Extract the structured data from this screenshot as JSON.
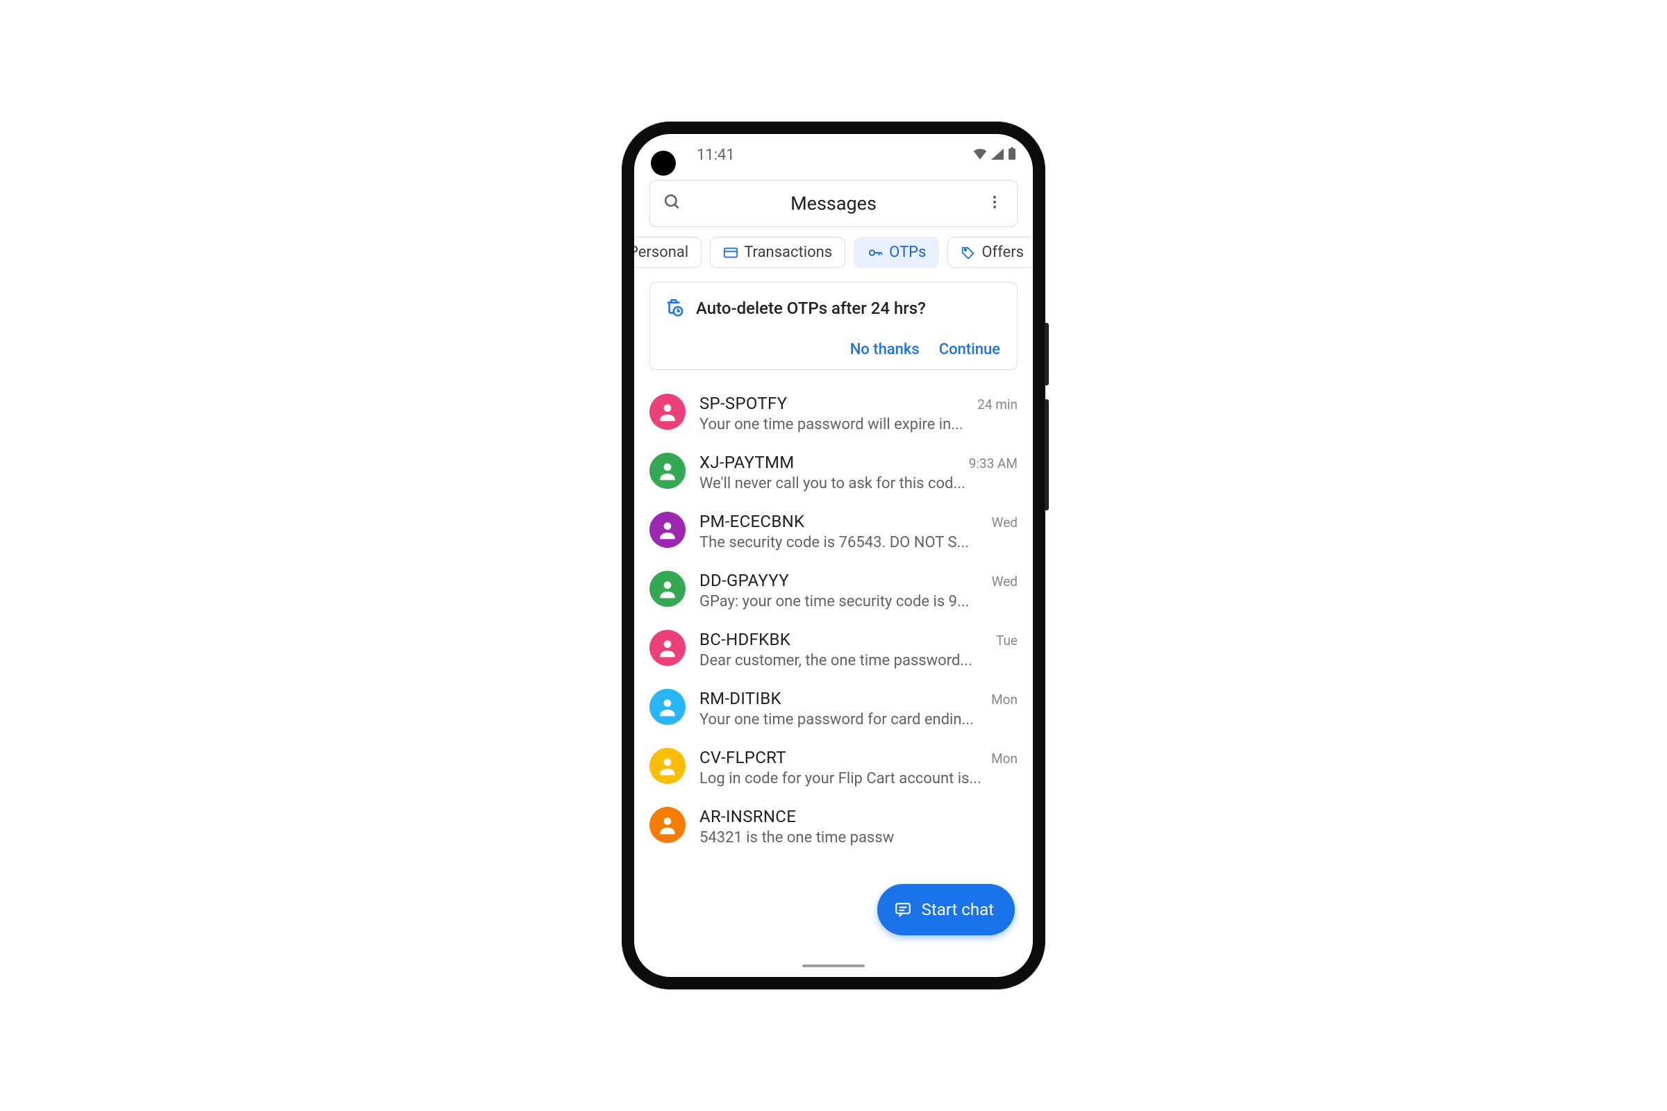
{
  "status": {
    "time": "11:41"
  },
  "appbar": {
    "title": "Messages"
  },
  "chips": [
    {
      "label": "Personal",
      "icon": null,
      "active": false,
      "first": true
    },
    {
      "label": "Transactions",
      "icon": "card",
      "iconColor": "#1a73e8",
      "active": false
    },
    {
      "label": "OTPs",
      "icon": "key",
      "iconColor": "#1a73e8",
      "active": true
    },
    {
      "label": "Offers",
      "icon": "tag",
      "iconColor": "#1a73e8",
      "active": false
    }
  ],
  "banner": {
    "title": "Auto-delete OTPs after 24 hrs?",
    "decline": "No thanks",
    "accept": "Continue"
  },
  "conversations": [
    {
      "sender": "SP-SPOTFY",
      "preview": "Your one time password will expire in...",
      "time": "24 min",
      "color": "#ec407a"
    },
    {
      "sender": "XJ-PAYTMM",
      "preview": "We'll never call you to ask for this cod...",
      "time": "9:33 AM",
      "color": "#34a853"
    },
    {
      "sender": "PM-ECECBNK",
      "preview": "The security code is 76543. DO NOT S...",
      "time": "Wed",
      "color": "#9c27b0"
    },
    {
      "sender": "DD-GPAYYY",
      "preview": "GPay: your one time security code is 9...",
      "time": "Wed",
      "color": "#34a853"
    },
    {
      "sender": "BC-HDFKBK",
      "preview": "Dear customer, the one time password...",
      "time": "Tue",
      "color": "#ec407a"
    },
    {
      "sender": "RM-DITIBK",
      "preview": "Your one time password for card endin...",
      "time": "Mon",
      "color": "#29b6f6"
    },
    {
      "sender": "CV-FLPCRT",
      "preview": "Log in code for your Flip Cart account is...",
      "time": "Mon",
      "color": "#fbbc04"
    },
    {
      "sender": "AR-INSRNCE",
      "preview": "54321 is the one time passw",
      "time": "",
      "color": "#f57c00"
    }
  ],
  "fab": {
    "label": "Start chat"
  }
}
